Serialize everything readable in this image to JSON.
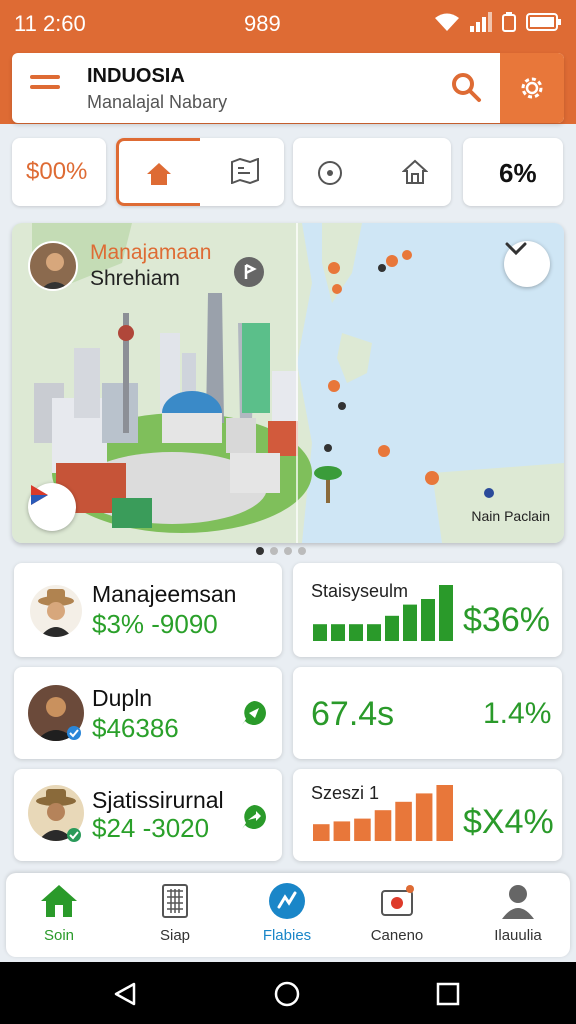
{
  "status": {
    "time": "11 2:60",
    "center": "989"
  },
  "header": {
    "title": "INDUOSIA",
    "subtitle": "Manalajal Nabary"
  },
  "chips": {
    "left_value": "$00%",
    "right_value": "6%"
  },
  "map": {
    "title": "Manajamaan",
    "subtitle": "Shrehiam",
    "place_label": "Nain Paclain"
  },
  "cards": [
    {
      "name": "Manajeemsan",
      "value": "$3% -9090"
    },
    {
      "label": "Staisyseulm",
      "value": "$36%",
      "bar_levels": [
        0.3,
        0.3,
        0.3,
        0.3,
        0.45,
        0.65,
        0.75,
        1.0
      ]
    },
    {
      "name": "Dupln",
      "value": "$46386"
    },
    {
      "big_left": "67.4s",
      "big_right": "1.4%"
    },
    {
      "name": "Sjatissirurnal",
      "value": "$24 -3020"
    },
    {
      "label": "Szeszi 1",
      "value": "$X4%",
      "bar_levels": [
        0.3,
        0.35,
        0.4,
        0.55,
        0.7,
        0.85,
        1.0
      ]
    }
  ],
  "nav": {
    "items": [
      {
        "label": "Soin",
        "color": "#2a9a2a"
      },
      {
        "label": "Siap",
        "color": "#333333"
      },
      {
        "label": "Flabies",
        "color": "#1a86c8"
      },
      {
        "label": "Caneno",
        "color": "#333333"
      },
      {
        "label": "Ilauulia",
        "color": "#333333"
      }
    ]
  },
  "colors": {
    "brand": "#de6b34",
    "positive": "#2a9a2a",
    "accent_bars": "#e8773a"
  }
}
